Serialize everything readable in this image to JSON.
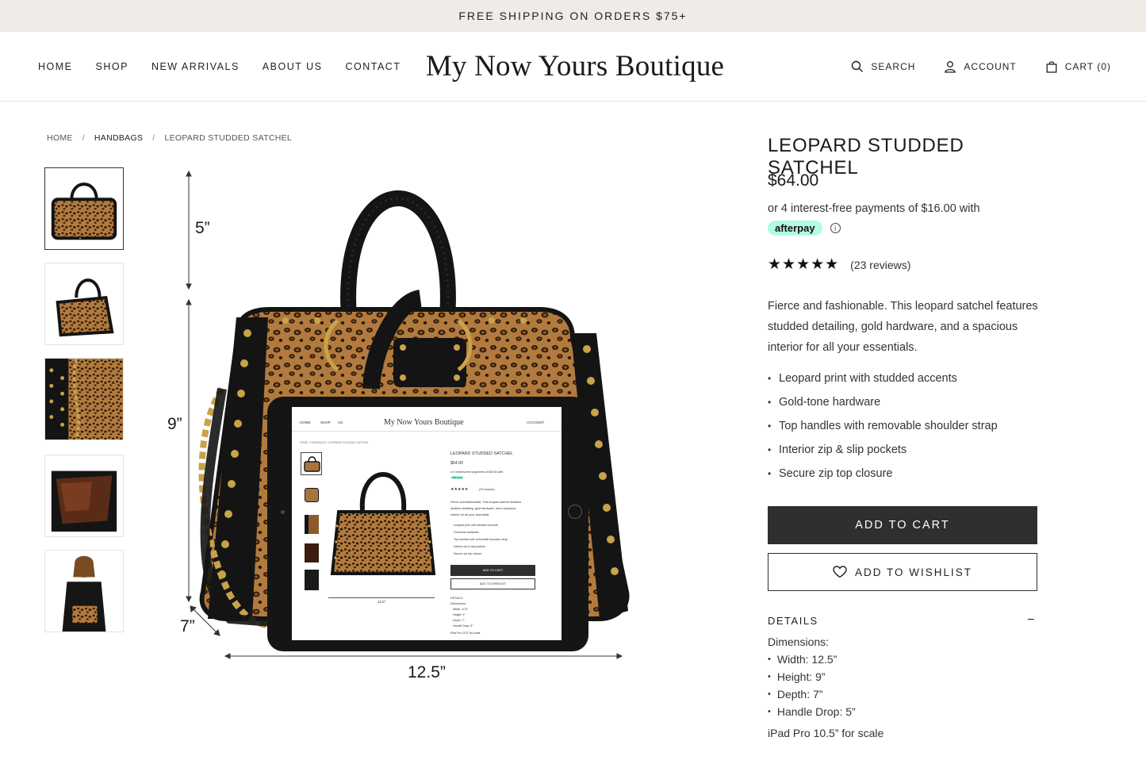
{
  "promo": {
    "text": "FREE SHIPPING ON ORDERS $75+"
  },
  "nav": {
    "left": [
      "HOME",
      "SHOP",
      "NEW ARRIVALS",
      "ABOUT US",
      "CONTACT"
    ],
    "logo": "My Now Yours Boutique",
    "search": "SEARCH",
    "account": "ACCOUNT",
    "cart": "CART (0)"
  },
  "breadcrumb": {
    "home": "HOME",
    "category": "HANDBAGS",
    "current": "LEOPARD STUDDED SATCHEL",
    "sep": "/"
  },
  "gallery": {
    "thumbnails": [
      "front-view",
      "angle-view",
      "side-studs-chain",
      "interior-view",
      "model-holding"
    ],
    "active_index": 0,
    "dimensions": {
      "handle_drop": "5”",
      "height": "9”",
      "depth": "7”",
      "width": "12.5”"
    }
  },
  "product": {
    "title": "LEOPARD STUDDED SATCHEL",
    "price": "$64.00",
    "afterpay_text": "or 4 interest-free payments of $16.00 with",
    "afterpay_label": "afterpay",
    "afterpay_info": "i",
    "rating": 5,
    "stars": "★★★★★",
    "reviews": "(23 reviews)",
    "description": "Fierce and fashionable. This leopard satchel features studded detailing, gold hardware, and a spacious interior for all your essentials.",
    "features": [
      "Leopard print with studded accents",
      "Gold-tone hardware",
      "Top handles with removable shoulder strap",
      "Interior zip & slip pockets",
      "Secure zip top closure"
    ],
    "add_to_cart": "ADD TO CART",
    "add_to_wishlist": "ADD TO WISHLIST",
    "details_heading": "DETAILS",
    "details_toggle": "−",
    "dimensions_label": "Dimensions:",
    "dimensions": [
      "Width: 12.5”",
      "Height: 9”",
      "Depth: 7”",
      "Handle Drop: 5”"
    ],
    "scale_note": "iPad Pro 10.5” for scale"
  },
  "ipad_screen": {
    "nav": [
      "HOME",
      "SHOP",
      "US"
    ],
    "logo": "My Now Yours Boutique",
    "account": "ACCOUNT",
    "breadcrumb": "HOME  /  HANDBAGS  /  LEOPARD STUDDED SATCHEL",
    "title": "LEOPARD STUDDED SATCHEL",
    "price": "$64.00",
    "afterpay": "or 4 interest-free payments of $16.00 with",
    "badge": "afterpay",
    "stars": "★★★★★",
    "reviews": "(23 reviews)",
    "desc1": "Fierce and fashionable. This leopard satchel features",
    "desc2": "studded detailing, gold hardware, and a spacious",
    "desc3": "interior for all your essentials.",
    "features": [
      "Leopard print with studded accents",
      "Gold-tone hardware",
      "Top handles with removable shoulder strap",
      "Interior zip & slip pockets",
      "Secure zip top closure"
    ],
    "cart": "ADD TO CART",
    "wishlist": "ADD TO WISHLIST",
    "details": "DETAILS",
    "dim_label": "Dimensions:",
    "dims": [
      "Width: 12.5”",
      "Height: 9”",
      "Depth: 7”",
      "Handle Drop: 5”"
    ],
    "scale": "iPad Pro 10.5” for scale",
    "width_label": "12.5”"
  },
  "colors": {
    "promo_bg": "#efece7",
    "button_dark": "#2f2f2f",
    "afterpay_mint": "#b2fce4",
    "leopard_base": "#a8733c",
    "leather_black": "#141414",
    "gold": "#c9a24a"
  }
}
